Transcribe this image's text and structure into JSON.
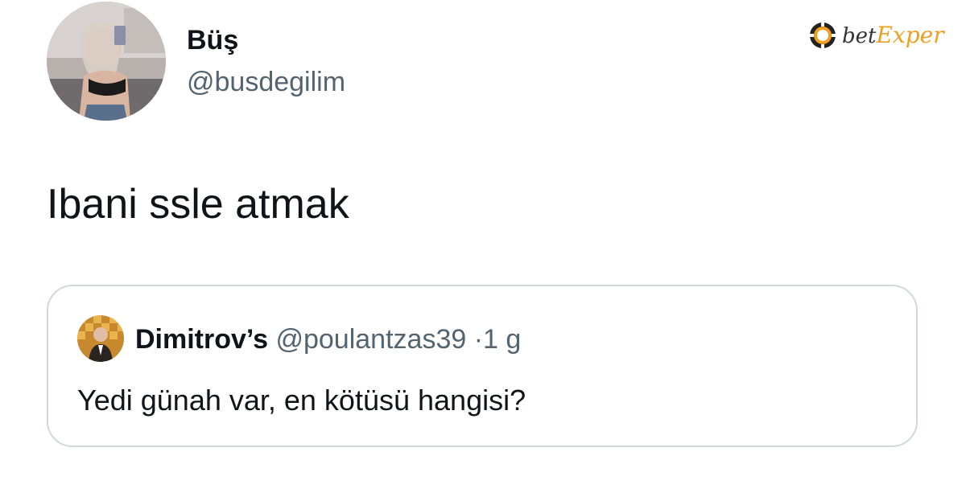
{
  "tweet": {
    "author_name": "Büş",
    "author_handle": "@busdegilim",
    "text": "Ibani ssle atmak"
  },
  "quoted_tweet": {
    "author_name": "Dimitrov’s",
    "author_handle": "@poulantzas39",
    "separator": "·",
    "time": "1 g",
    "text": "Yedi günah var, en kötüsü hangisi?"
  },
  "watermark": {
    "brand_prefix": "bet",
    "brand_suffix": "Exper",
    "accent_color": "#f0a020"
  },
  "icons": {
    "brand": "poker-chip-icon"
  }
}
